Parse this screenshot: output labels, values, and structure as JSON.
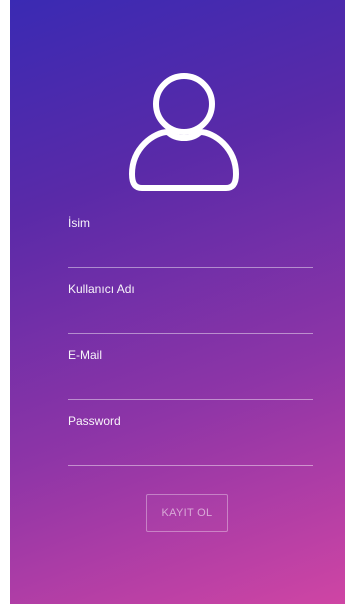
{
  "theme": {
    "gradient_start": "#3a2ab3",
    "gradient_end": "#cf45a4",
    "text_color": "#ffffff"
  },
  "header": {
    "icon": "user-avatar-icon"
  },
  "form": {
    "fields": [
      {
        "label": "İsim",
        "value": ""
      },
      {
        "label": "Kullanıcı Adı",
        "value": ""
      },
      {
        "label": "E-Mail",
        "value": ""
      },
      {
        "label": "Password",
        "value": ""
      }
    ],
    "submit_label": "KAYIT OL"
  }
}
